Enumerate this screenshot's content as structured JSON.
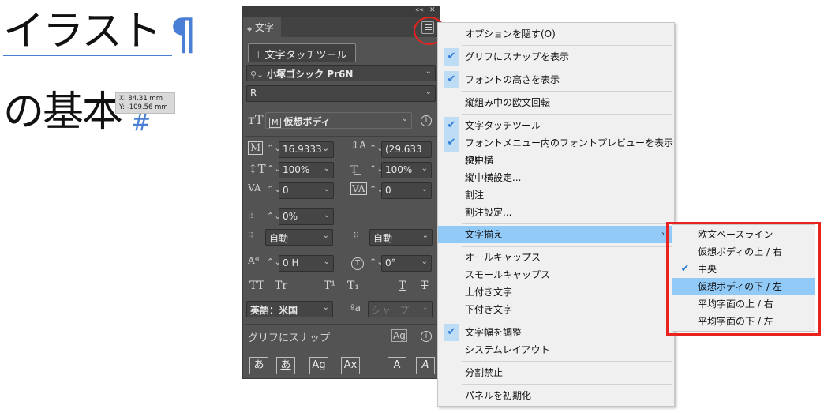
{
  "document": {
    "line1": "イラスト",
    "line2": "の基本",
    "pilcrow": "¶",
    "hash": "#",
    "tooltip_x": "X: 84.31 mm",
    "tooltip_y": "Y: -109.56 mm"
  },
  "panel": {
    "topbar_collapse": "««",
    "topbar_close": "✕",
    "tab_label": "文字",
    "touch_tool_label": "文字タッチツール",
    "font_family": "小塚ゴシック Pr6N",
    "font_style": "R",
    "baseline_mode": "仮想ボディ",
    "baseline_prefix": "M",
    "font_size": "16.9333",
    "leading": "(29.633",
    "vertical_scale": "100%",
    "horizontal_scale": "100%",
    "kerning": "0",
    "tracking": "0",
    "tsume": "0%",
    "aki_left": "自動",
    "aki_right": "自動",
    "baseline_shift": "0 H",
    "rotation": "0°",
    "caps_tt": "TT",
    "caps_tr": "Tr",
    "sup": "T¹",
    "sub": "T₁",
    "underline_t": "T",
    "strike_t": "T",
    "language": "英語：米国",
    "aa_label": "ªa",
    "antialias": "シャープ",
    "glyph_snap_label": "グリフにスナップ",
    "bottom_buttons": [
      "あ",
      "あ",
      "Ag",
      "Ax",
      "A",
      "A"
    ]
  },
  "context_menu": {
    "items": [
      {
        "label": "オプションを隠す(O)",
        "checked": false
      },
      {
        "label": "グリフにスナップを表示",
        "checked": true
      },
      {
        "label": "フォントの高さを表示",
        "checked": true
      },
      {
        "label": "縦組み中の欧文回転",
        "checked": false
      },
      {
        "label": "文字タッチツール",
        "checked": true
      },
      {
        "label": "フォントメニュー内のフォントプレビューを表示(P)",
        "checked": true
      },
      {
        "label": "縦中横",
        "checked": false
      },
      {
        "label": "縦中横設定...",
        "checked": false
      },
      {
        "label": "割注",
        "checked": false
      },
      {
        "label": "割注設定...",
        "checked": false
      },
      {
        "label": "文字揃え",
        "checked": false
      },
      {
        "label": "オールキャップス",
        "checked": false
      },
      {
        "label": "スモールキャップス",
        "checked": false
      },
      {
        "label": "上付き文字",
        "checked": false
      },
      {
        "label": "下付き文字",
        "checked": false
      },
      {
        "label": "文字幅を調整",
        "checked": true
      },
      {
        "label": "システムレイアウト",
        "checked": false
      },
      {
        "label": "分割禁止",
        "checked": false
      },
      {
        "label": "パネルを初期化",
        "checked": false
      }
    ],
    "submenu_arrow": "›",
    "check_glyph": "✔"
  },
  "submenu": {
    "items": [
      {
        "label": "欧文ベースライン",
        "checked": false
      },
      {
        "label": "仮想ボディの上 / 右",
        "checked": false
      },
      {
        "label": "中央",
        "checked": true
      },
      {
        "label": "仮想ボディの下 / 左",
        "checked": false
      },
      {
        "label": "平均字面の上 / 右",
        "checked": false
      },
      {
        "label": "平均字面の下 / 左",
        "checked": false
      }
    ]
  },
  "colors": {
    "panel_bg": "#535353",
    "highlight": "#91c9f7",
    "annotation_red": "#e8231f",
    "text_blue": "#4a7fd6"
  }
}
